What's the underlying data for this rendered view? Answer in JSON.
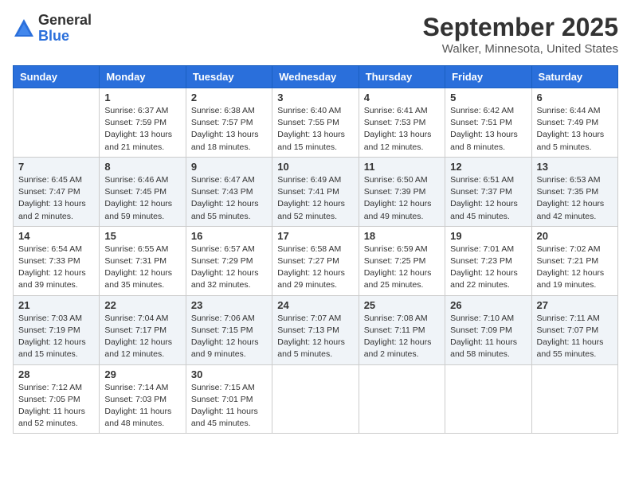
{
  "logo": {
    "general": "General",
    "blue": "Blue"
  },
  "title": "September 2025",
  "location": "Walker, Minnesota, United States",
  "days_header": [
    "Sunday",
    "Monday",
    "Tuesday",
    "Wednesday",
    "Thursday",
    "Friday",
    "Saturday"
  ],
  "weeks": [
    [
      {
        "num": "",
        "info": ""
      },
      {
        "num": "1",
        "info": "Sunrise: 6:37 AM\nSunset: 7:59 PM\nDaylight: 13 hours\nand 21 minutes."
      },
      {
        "num": "2",
        "info": "Sunrise: 6:38 AM\nSunset: 7:57 PM\nDaylight: 13 hours\nand 18 minutes."
      },
      {
        "num": "3",
        "info": "Sunrise: 6:40 AM\nSunset: 7:55 PM\nDaylight: 13 hours\nand 15 minutes."
      },
      {
        "num": "4",
        "info": "Sunrise: 6:41 AM\nSunset: 7:53 PM\nDaylight: 13 hours\nand 12 minutes."
      },
      {
        "num": "5",
        "info": "Sunrise: 6:42 AM\nSunset: 7:51 PM\nDaylight: 13 hours\nand 8 minutes."
      },
      {
        "num": "6",
        "info": "Sunrise: 6:44 AM\nSunset: 7:49 PM\nDaylight: 13 hours\nand 5 minutes."
      }
    ],
    [
      {
        "num": "7",
        "info": "Sunrise: 6:45 AM\nSunset: 7:47 PM\nDaylight: 13 hours\nand 2 minutes."
      },
      {
        "num": "8",
        "info": "Sunrise: 6:46 AM\nSunset: 7:45 PM\nDaylight: 12 hours\nand 59 minutes."
      },
      {
        "num": "9",
        "info": "Sunrise: 6:47 AM\nSunset: 7:43 PM\nDaylight: 12 hours\nand 55 minutes."
      },
      {
        "num": "10",
        "info": "Sunrise: 6:49 AM\nSunset: 7:41 PM\nDaylight: 12 hours\nand 52 minutes."
      },
      {
        "num": "11",
        "info": "Sunrise: 6:50 AM\nSunset: 7:39 PM\nDaylight: 12 hours\nand 49 minutes."
      },
      {
        "num": "12",
        "info": "Sunrise: 6:51 AM\nSunset: 7:37 PM\nDaylight: 12 hours\nand 45 minutes."
      },
      {
        "num": "13",
        "info": "Sunrise: 6:53 AM\nSunset: 7:35 PM\nDaylight: 12 hours\nand 42 minutes."
      }
    ],
    [
      {
        "num": "14",
        "info": "Sunrise: 6:54 AM\nSunset: 7:33 PM\nDaylight: 12 hours\nand 39 minutes."
      },
      {
        "num": "15",
        "info": "Sunrise: 6:55 AM\nSunset: 7:31 PM\nDaylight: 12 hours\nand 35 minutes."
      },
      {
        "num": "16",
        "info": "Sunrise: 6:57 AM\nSunset: 7:29 PM\nDaylight: 12 hours\nand 32 minutes."
      },
      {
        "num": "17",
        "info": "Sunrise: 6:58 AM\nSunset: 7:27 PM\nDaylight: 12 hours\nand 29 minutes."
      },
      {
        "num": "18",
        "info": "Sunrise: 6:59 AM\nSunset: 7:25 PM\nDaylight: 12 hours\nand 25 minutes."
      },
      {
        "num": "19",
        "info": "Sunrise: 7:01 AM\nSunset: 7:23 PM\nDaylight: 12 hours\nand 22 minutes."
      },
      {
        "num": "20",
        "info": "Sunrise: 7:02 AM\nSunset: 7:21 PM\nDaylight: 12 hours\nand 19 minutes."
      }
    ],
    [
      {
        "num": "21",
        "info": "Sunrise: 7:03 AM\nSunset: 7:19 PM\nDaylight: 12 hours\nand 15 minutes."
      },
      {
        "num": "22",
        "info": "Sunrise: 7:04 AM\nSunset: 7:17 PM\nDaylight: 12 hours\nand 12 minutes."
      },
      {
        "num": "23",
        "info": "Sunrise: 7:06 AM\nSunset: 7:15 PM\nDaylight: 12 hours\nand 9 minutes."
      },
      {
        "num": "24",
        "info": "Sunrise: 7:07 AM\nSunset: 7:13 PM\nDaylight: 12 hours\nand 5 minutes."
      },
      {
        "num": "25",
        "info": "Sunrise: 7:08 AM\nSunset: 7:11 PM\nDaylight: 12 hours\nand 2 minutes."
      },
      {
        "num": "26",
        "info": "Sunrise: 7:10 AM\nSunset: 7:09 PM\nDaylight: 11 hours\nand 58 minutes."
      },
      {
        "num": "27",
        "info": "Sunrise: 7:11 AM\nSunset: 7:07 PM\nDaylight: 11 hours\nand 55 minutes."
      }
    ],
    [
      {
        "num": "28",
        "info": "Sunrise: 7:12 AM\nSunset: 7:05 PM\nDaylight: 11 hours\nand 52 minutes."
      },
      {
        "num": "29",
        "info": "Sunrise: 7:14 AM\nSunset: 7:03 PM\nDaylight: 11 hours\nand 48 minutes."
      },
      {
        "num": "30",
        "info": "Sunrise: 7:15 AM\nSunset: 7:01 PM\nDaylight: 11 hours\nand 45 minutes."
      },
      {
        "num": "",
        "info": ""
      },
      {
        "num": "",
        "info": ""
      },
      {
        "num": "",
        "info": ""
      },
      {
        "num": "",
        "info": ""
      }
    ]
  ]
}
